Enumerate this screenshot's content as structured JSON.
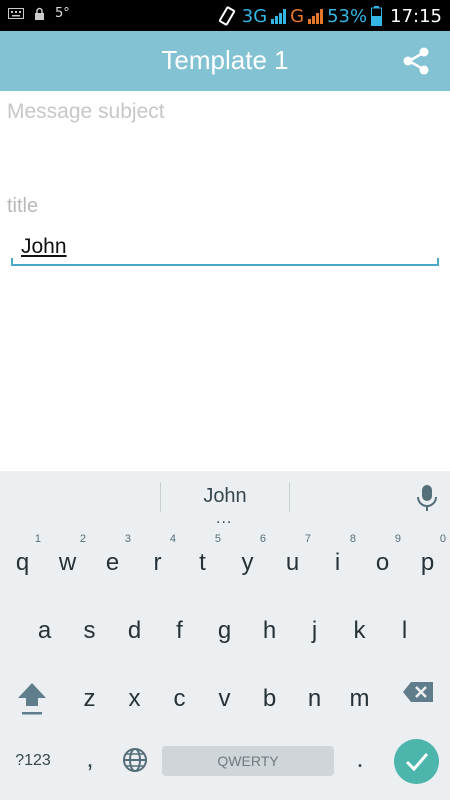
{
  "status_bar": {
    "notification": "5°",
    "network_1": "3G",
    "network_2": "G",
    "battery_percent": "53%",
    "time": "17:15",
    "icons": [
      "keyboard-icon",
      "lock-icon",
      "vibrate-icon",
      "signal-icon",
      "battery-icon"
    ]
  },
  "toolbar": {
    "title": "Template 1",
    "share_icon": "share-icon",
    "background": "#82c2d3"
  },
  "form": {
    "subject_placeholder": "Message subject",
    "title_label": "title",
    "title_value": "John",
    "accent": "#4aa8c9"
  },
  "keyboard": {
    "suggestion": "John",
    "suggestion_more": "...",
    "row1": [
      {
        "k": "q",
        "n": "1"
      },
      {
        "k": "w",
        "n": "2"
      },
      {
        "k": "e",
        "n": "3"
      },
      {
        "k": "r",
        "n": "4"
      },
      {
        "k": "t",
        "n": "5"
      },
      {
        "k": "y",
        "n": "6"
      },
      {
        "k": "u",
        "n": "7"
      },
      {
        "k": "i",
        "n": "8"
      },
      {
        "k": "o",
        "n": "9"
      },
      {
        "k": "p",
        "n": "0"
      }
    ],
    "row2": [
      "a",
      "s",
      "d",
      "f",
      "g",
      "h",
      "j",
      "k",
      "l"
    ],
    "row3": [
      "z",
      "x",
      "c",
      "v",
      "b",
      "n",
      "m"
    ],
    "symbols_label": "?123",
    "comma": ",",
    "space_label": "QWERTY",
    "period": ".",
    "enter_color": "#4db6ac"
  }
}
